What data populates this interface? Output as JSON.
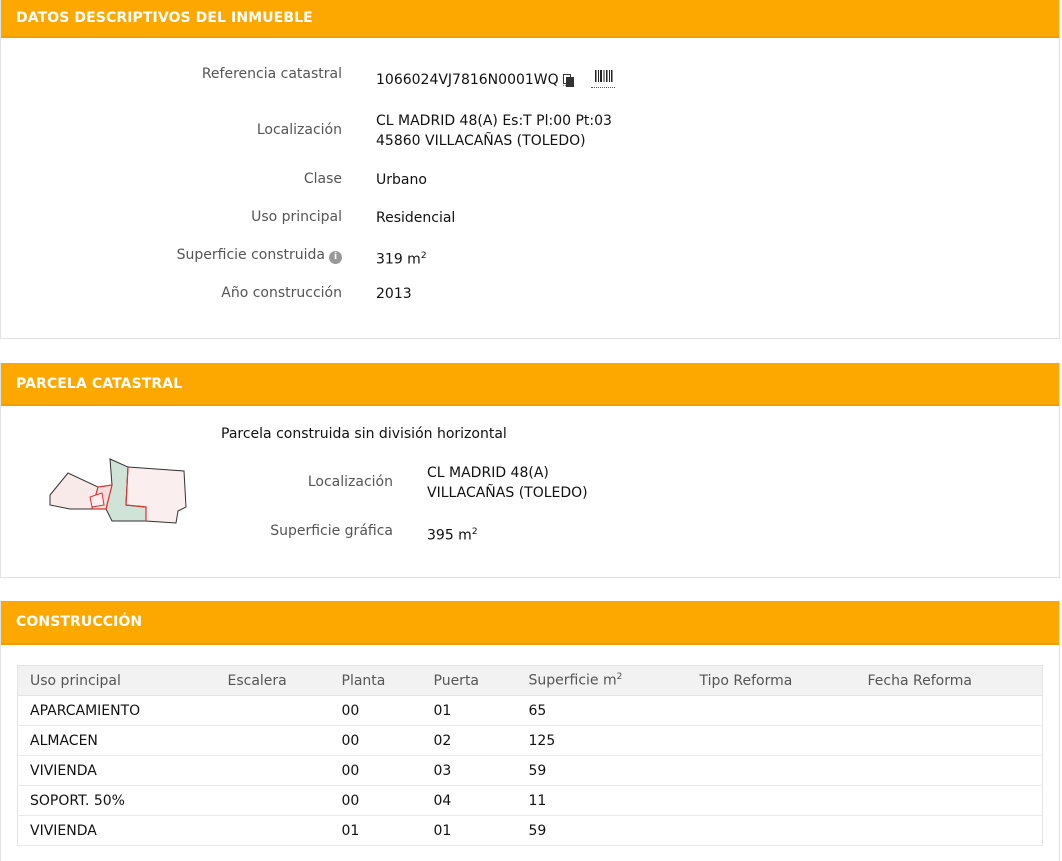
{
  "inmueble": {
    "title": "DATOS DESCRIPTIVOS DEL INMUEBLE",
    "ref_label": "Referencia catastral",
    "ref_value": "1066024VJ7816N0001WQ",
    "loc_label": "Localización",
    "loc_line1": "CL MADRID 48(A) Es:T Pl:00 Pt:03",
    "loc_line2": "45860 VILLACAÑAS (TOLEDO)",
    "clase_label": "Clase",
    "clase_value": "Urbano",
    "uso_label": "Uso principal",
    "uso_value": "Residencial",
    "sup_label": "Superficie construida",
    "sup_value": "319 m",
    "sup_unit_exp": "2",
    "anio_label": "Año construcción",
    "anio_value": "2013"
  },
  "parcela": {
    "title": "PARCELA CATASTRAL",
    "subtitle": "Parcela construida sin división horizontal",
    "loc_label": "Localización",
    "loc_line1": "CL MADRID 48(A)",
    "loc_line2": "VILLACAÑAS (TOLEDO)",
    "sup_label": "Superficie gráfica",
    "sup_value": "395 m",
    "sup_unit_exp": "2"
  },
  "construccion": {
    "title": "CONSTRUCCIÓN",
    "headers": [
      "Uso principal",
      "Escalera",
      "Planta",
      "Puerta",
      "Superficie m",
      "Tipo Reforma",
      "Fecha Reforma"
    ],
    "superficie_exp": "2",
    "rows": [
      [
        "APARCAMIENTO",
        "",
        "00",
        "01",
        "65",
        "",
        ""
      ],
      [
        "ALMACEN",
        "",
        "00",
        "02",
        "125",
        "",
        ""
      ],
      [
        "VIVIENDA",
        "",
        "00",
        "03",
        "59",
        "",
        ""
      ],
      [
        "SOPORT. 50%",
        "",
        "00",
        "04",
        "11",
        "",
        ""
      ],
      [
        "VIVIENDA",
        "",
        "01",
        "01",
        "59",
        "",
        ""
      ]
    ]
  },
  "colors": {
    "header_bg": "#fca800",
    "header_text": "#ffffff"
  },
  "icons": [
    "copy-icon",
    "barcode-icon",
    "info-icon",
    "parcel-map-icon"
  ]
}
